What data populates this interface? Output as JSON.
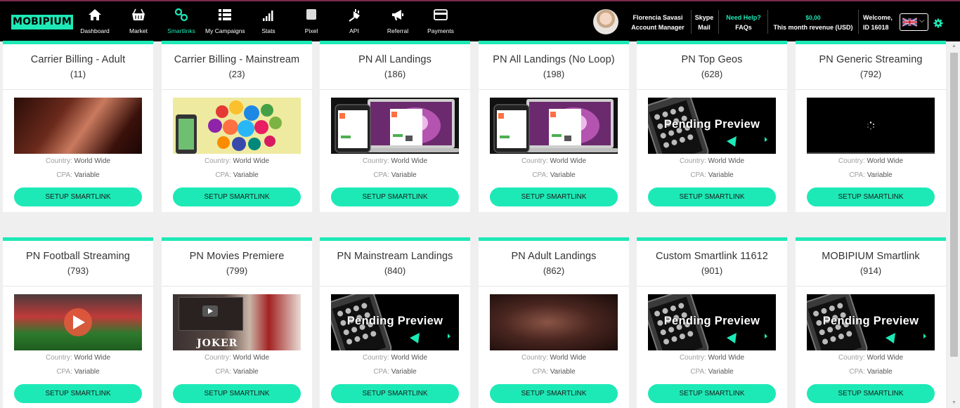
{
  "brand": {
    "logo": "MOBIPIUM",
    "accent": "#1de9b6"
  },
  "nav": [
    {
      "label": "Dashboard",
      "icon": "home-icon",
      "active": false
    },
    {
      "label": "Market",
      "icon": "basket-icon",
      "active": false
    },
    {
      "label": "Smartlinks",
      "icon": "link-icon",
      "active": true
    },
    {
      "label": "My Campaigns",
      "icon": "grid-icon",
      "active": false
    },
    {
      "label": "Stats",
      "icon": "bar-chart-icon",
      "active": false
    },
    {
      "label": "Pixel",
      "icon": "square-icon",
      "active": false
    },
    {
      "label": "API",
      "icon": "plug-icon",
      "active": false
    },
    {
      "label": "Referral",
      "icon": "megaphone-icon",
      "active": false
    },
    {
      "label": "Payments",
      "icon": "credit-card-icon",
      "active": false
    }
  ],
  "header": {
    "manager_name": "Florencia Savasi",
    "manager_role": "Account Manager",
    "skype_line1": "Skype",
    "skype_line2": "Mail",
    "help_line1": "Need Help?",
    "help_line2": "FAQs",
    "revenue_value": "$0,00",
    "revenue_label": "This month revenue (USD)",
    "welcome": "Welcome,",
    "user_id": "ID 16018"
  },
  "cards": [
    {
      "title": "Carrier Billing - Adult",
      "count": "(11)",
      "thumb": "adult",
      "country_label": "Country:",
      "country": "World Wide",
      "cpa_label": "CPA:",
      "cpa": "Variable",
      "button": "SETUP SMARTLINK"
    },
    {
      "title": "Carrier Billing - Mainstream",
      "count": "(23)",
      "thumb": "apps",
      "country_label": "Country:",
      "country": "World Wide",
      "cpa_label": "CPA:",
      "cpa": "Variable",
      "button": "SETUP SMARTLINK"
    },
    {
      "title": "PN All Landings",
      "count": "(186)",
      "thumb": "mac",
      "country_label": "Country:",
      "country": "World Wide",
      "cpa_label": "CPA:",
      "cpa": "Variable",
      "button": "SETUP SMARTLINK"
    },
    {
      "title": "PN All Landings (No Loop)",
      "count": "(198)",
      "thumb": "mac",
      "country_label": "Country:",
      "country": "World Wide",
      "cpa_label": "CPA:",
      "cpa": "Variable",
      "button": "SETUP SMARTLINK"
    },
    {
      "title": "PN Top Geos",
      "count": "(628)",
      "thumb": "pending",
      "pending_text": "Pending Preview",
      "country_label": "Country:",
      "country": "World Wide",
      "cpa_label": "CPA:",
      "cpa": "Variable",
      "button": "SETUP SMARTLINK"
    },
    {
      "title": "PN Generic Streaming",
      "count": "(792)",
      "thumb": "black",
      "country_label": "Country:",
      "country": "World Wide",
      "cpa_label": "CPA:",
      "cpa": "Variable",
      "button": "SETUP SMARTLINK"
    },
    {
      "title": "PN Football Streaming",
      "count": "(793)",
      "thumb": "foot",
      "country_label": "Country:",
      "country": "World Wide",
      "cpa_label": "CPA:",
      "cpa": "Variable",
      "button": "SETUP SMARTLINK"
    },
    {
      "title": "PN Movies Premiere",
      "count": "(799)",
      "thumb": "joker",
      "thumb_text": "JOKER",
      "country_label": "Country:",
      "country": "World Wide",
      "cpa_label": "CPA:",
      "cpa": "Variable",
      "button": "SETUP SMARTLINK"
    },
    {
      "title": "PN Mainstream Landings",
      "count": "(840)",
      "thumb": "pending",
      "pending_text": "Pending Preview",
      "country_label": "Country:",
      "country": "World Wide",
      "cpa_label": "CPA:",
      "cpa": "Variable",
      "button": "SETUP SMARTLINK"
    },
    {
      "title": "PN Adult Landings",
      "count": "(862)",
      "thumb": "adult2",
      "country_label": "Country:",
      "country": "World Wide",
      "cpa_label": "CPA:",
      "cpa": "Variable",
      "button": "SETUP SMARTLINK"
    },
    {
      "title": "Custom Smartlink 11612",
      "count": "(901)",
      "thumb": "pending",
      "pending_text": "Pending Preview",
      "country_label": "Country:",
      "country": "World Wide",
      "cpa_label": "CPA:",
      "cpa": "Variable",
      "button": "SETUP SMARTLINK"
    },
    {
      "title": "MOBIPIUM Smartlink",
      "count": "(914)",
      "thumb": "pending",
      "pending_text": "Pending Preview",
      "country_label": "Country:",
      "country": "World Wide",
      "cpa_label": "CPA:",
      "cpa": "Variable",
      "button": "SETUP SMARTLINK"
    }
  ]
}
